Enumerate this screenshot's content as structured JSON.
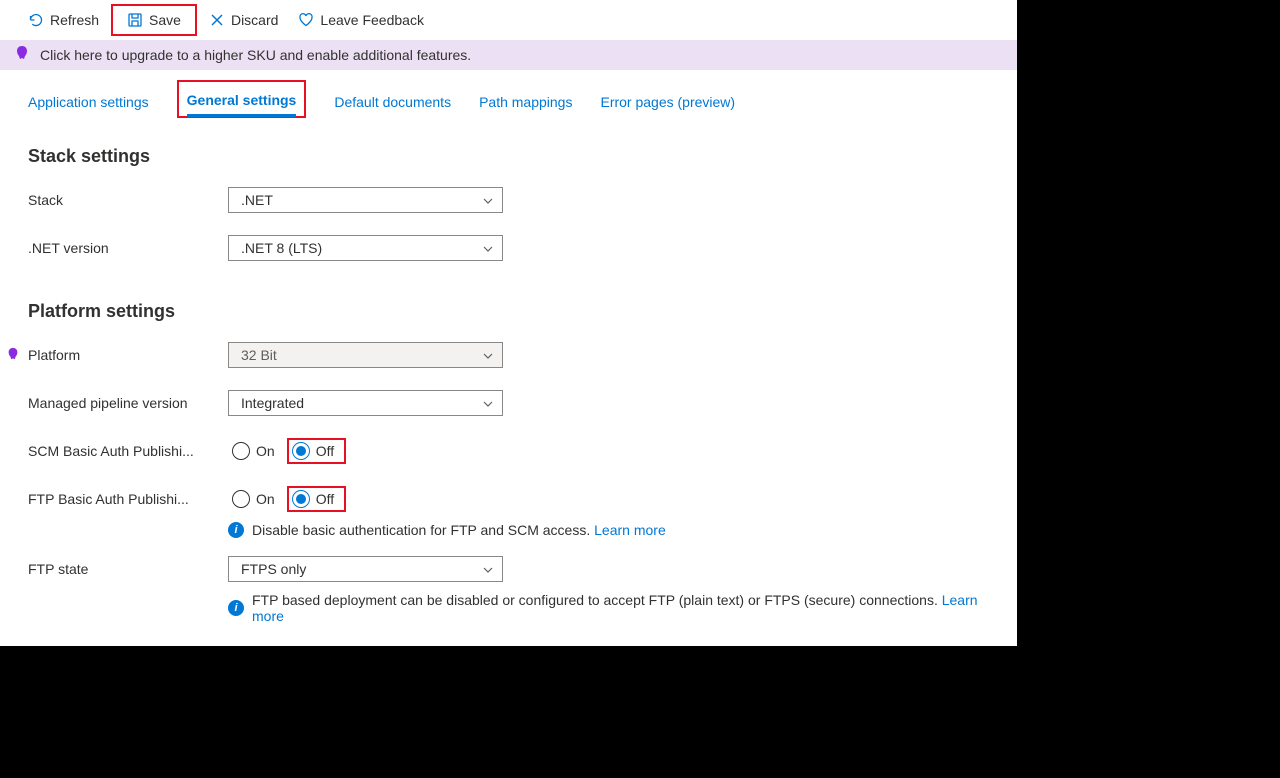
{
  "toolbar": {
    "refresh": "Refresh",
    "save": "Save",
    "discard": "Discard",
    "feedback": "Leave Feedback"
  },
  "banner": {
    "text": "Click here to upgrade to a higher SKU and enable additional features."
  },
  "tabs": {
    "app_settings": "Application settings",
    "general": "General settings",
    "default_docs": "Default documents",
    "path_mappings": "Path mappings",
    "error_pages": "Error pages (preview)"
  },
  "stack": {
    "heading": "Stack settings",
    "stack_label": "Stack",
    "stack_value": ".NET",
    "net_version_label": ".NET version",
    "net_version_value": ".NET 8 (LTS)"
  },
  "platform": {
    "heading": "Platform settings",
    "platform_label": "Platform",
    "platform_value": "32 Bit",
    "pipeline_label": "Managed pipeline version",
    "pipeline_value": "Integrated",
    "scm_label": "SCM Basic Auth Publishi...",
    "ftp_label": "FTP Basic Auth Publishi...",
    "on": "On",
    "off": "Off",
    "basic_auth_info": "Disable basic authentication for FTP and SCM access.",
    "learn_more": "Learn more",
    "ftp_state_label": "FTP state",
    "ftp_state_value": "FTPS only",
    "ftp_state_info": "FTP based deployment can be disabled or configured to accept FTP (plain text) or FTPS (secure) connections."
  }
}
